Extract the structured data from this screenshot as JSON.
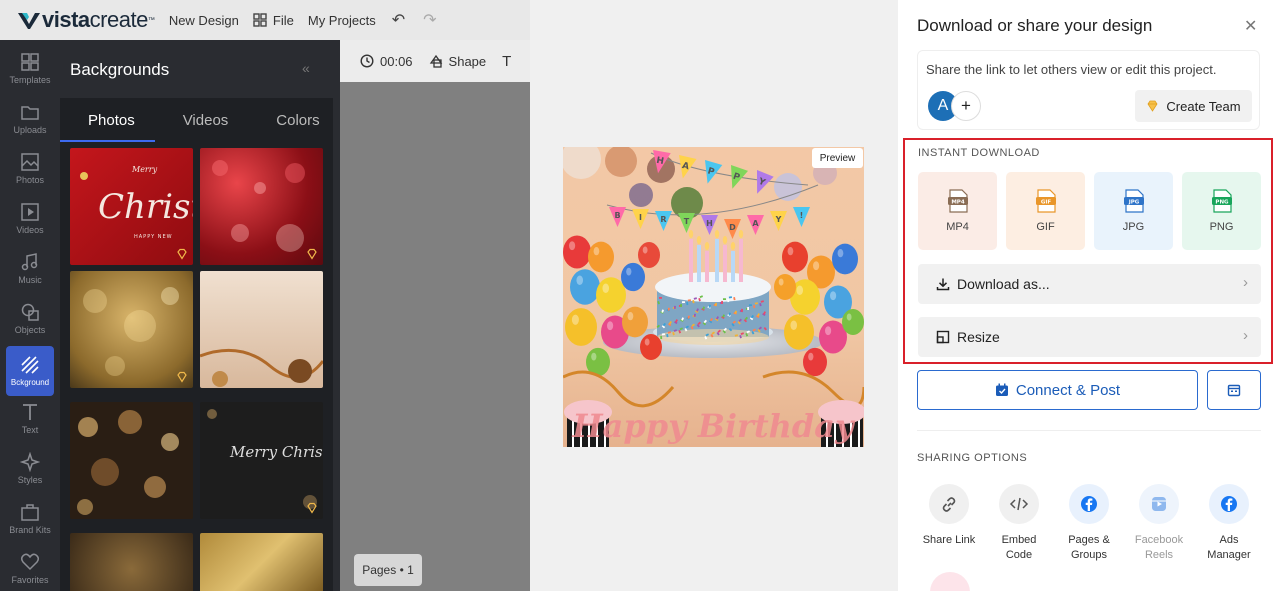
{
  "topbar": {
    "logo_bold": "vista",
    "logo_light": "create",
    "logo_tm": "™",
    "new_design": "New Design",
    "file": "File",
    "my_projects": "My Projects"
  },
  "rail": {
    "items": [
      {
        "label": "Templates",
        "icon": "templates-icon"
      },
      {
        "label": "Uploads",
        "icon": "uploads-icon"
      },
      {
        "label": "Photos",
        "icon": "photos-icon"
      },
      {
        "label": "Videos",
        "icon": "videos-icon"
      },
      {
        "label": "Music",
        "icon": "music-icon"
      },
      {
        "label": "Objects",
        "icon": "objects-icon"
      },
      {
        "label": "Bckground",
        "icon": "background-icon",
        "active": true
      },
      {
        "label": "Text",
        "icon": "text-icon"
      },
      {
        "label": "Styles",
        "icon": "styles-icon"
      },
      {
        "label": "Brand Kits",
        "icon": "brand-kits-icon"
      },
      {
        "label": "Favorites",
        "icon": "favorites-icon"
      }
    ]
  },
  "backgrounds": {
    "title": "Backgrounds",
    "tabs": [
      "Photos",
      "Videos",
      "Colors"
    ],
    "active_tab": "Photos",
    "thumb_text_1": "Christmas",
    "thumb_text_1_sub": "HAPPY NEW",
    "thumb_text_2": "Merry Christmas"
  },
  "canvas_toolbar": {
    "time": "00:06",
    "shape": "Shape"
  },
  "pages_label": "Pages • 1",
  "preview_label": "Preview",
  "design": {
    "bunting_1": [
      "H",
      "A",
      "P",
      "P",
      "Y"
    ],
    "bunting_2": [
      "B",
      "I",
      "R",
      "T",
      "H",
      "D",
      "A",
      "Y",
      "!"
    ],
    "script_text": "Happy Birthday"
  },
  "right_panel": {
    "title": "Download or share your design",
    "share_text": "Share the link to let others view or edit this project.",
    "avatar_letter": "A",
    "add_symbol": "+",
    "create_team": "Create Team",
    "instant_download_label": "INSTANT DOWNLOAD",
    "formats": [
      {
        "label": "MP4",
        "badge": "MP4",
        "bg": "#fbece6",
        "color": "#8a6d55"
      },
      {
        "label": "GIF",
        "badge": "GIF",
        "bg": "#fdeee2",
        "color": "#e9962a"
      },
      {
        "label": "JPG",
        "badge": "JPG",
        "bg": "#e9f3fc",
        "color": "#2f74c8"
      },
      {
        "label": "PNG",
        "badge": "PNG",
        "bg": "#e6f7ee",
        "color": "#19a55b"
      }
    ],
    "download_as": "Download as...",
    "resize": "Resize",
    "connect_post": "Connect & Post",
    "sharing_options_label": "SHARING OPTIONS",
    "sharing_options": [
      {
        "line1": "Share Link",
        "line2": "",
        "icon": "link-icon"
      },
      {
        "line1": "Embed",
        "line2": "Code",
        "icon": "embed-code-icon"
      },
      {
        "line1": "Pages &",
        "line2": "Groups",
        "icon": "facebook-icon"
      },
      {
        "line1": "Facebook",
        "line2": "Reels",
        "icon": "facebook-reels-icon",
        "disabled": true
      },
      {
        "line1": "Ads",
        "line2": "Manager",
        "icon": "facebook-icon"
      }
    ]
  },
  "colors": {
    "accent_blue": "#2a6acf",
    "highlight_red": "#d9202a",
    "rail_bg": "#2a2c31",
    "active_rail": "#3a5cc9"
  }
}
